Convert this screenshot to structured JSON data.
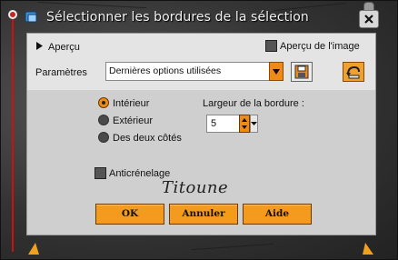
{
  "window": {
    "title": "Sélectionner les bordures de la sélection"
  },
  "preview": {
    "toggle_label": "Aperçu",
    "checkbox_label": "Aperçu de l'image",
    "checked": true
  },
  "presets": {
    "label": "Paramètres",
    "selected": "Dernières options utilisées"
  },
  "options": {
    "radios": [
      {
        "label": "Intérieur",
        "checked": true
      },
      {
        "label": "Extérieur",
        "checked": false
      },
      {
        "label": "Des deux côtés",
        "checked": false
      }
    ],
    "width_label": "Largeur de la bordure :",
    "width_value": "5",
    "antialias_label": "Anticrénelage",
    "antialias_checked": true
  },
  "signature": "Titoune",
  "buttons": {
    "ok": "OK",
    "cancel": "Annuler",
    "help": "Aide"
  },
  "colors": {
    "accent": "#f49a1e",
    "panel": "#cfcfcf",
    "rail": "#cc1111"
  },
  "icons": [
    "app-icon",
    "close-icon",
    "save-preset-icon",
    "reset-icon",
    "collapse-arrow-icon",
    "dropdown-arrow-icon",
    "spinner-icon"
  ]
}
